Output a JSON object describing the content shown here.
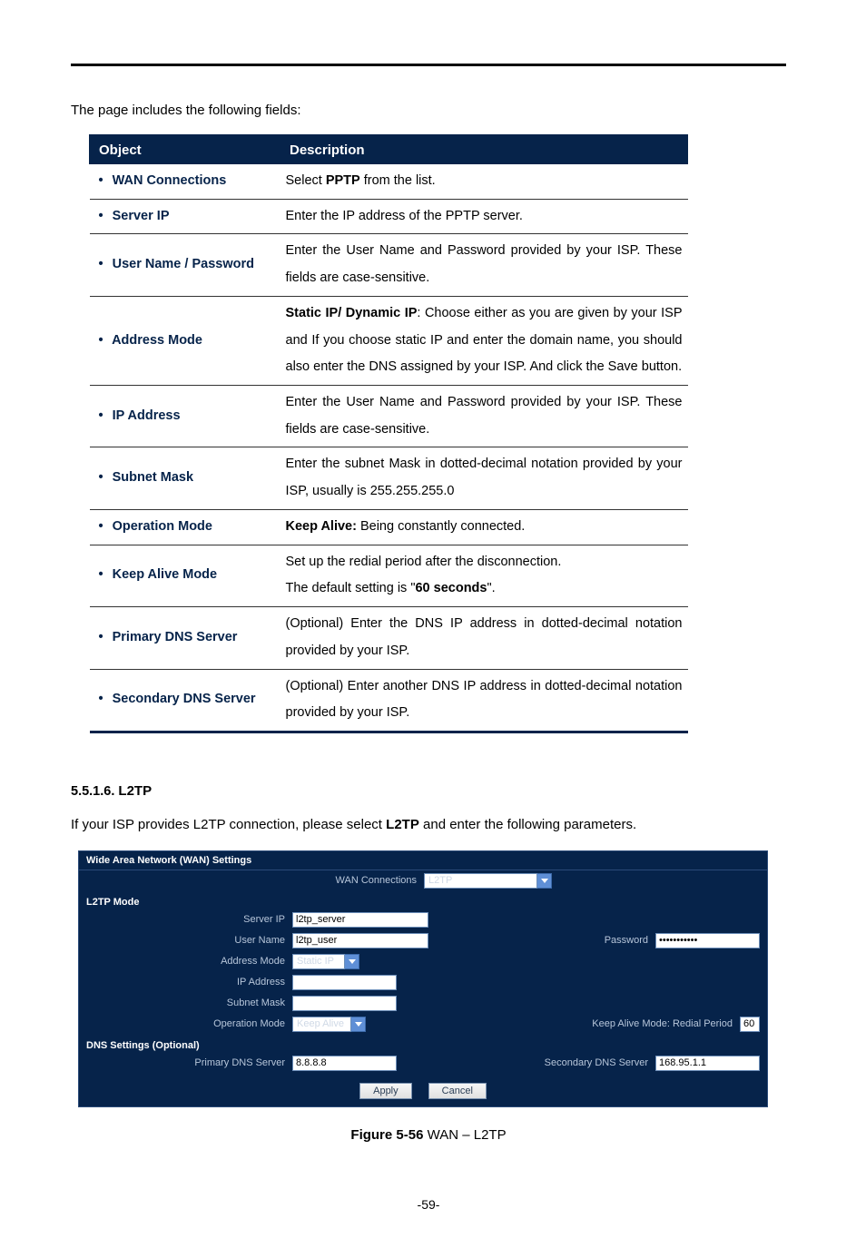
{
  "intro_text": "The page includes the following fields:",
  "table": {
    "head_object": "Object",
    "head_desc": "Description",
    "rows": [
      {
        "obj": "WAN Connections",
        "desc_html": "Select <b>PPTP</b> from the list."
      },
      {
        "obj": "Server IP",
        "desc_html": "Enter the IP address of the PPTP server."
      },
      {
        "obj": "User Name / Password",
        "desc_html": "Enter the User Name and Password provided by your ISP. These fields are case-sensitive."
      },
      {
        "obj": "Address Mode",
        "desc_html": "<b>Static IP/ Dynamic IP</b>: Choose either as you are given by your ISP and If you choose static IP and enter the domain name, you should also enter the DNS assigned by your ISP. And click the Save button."
      },
      {
        "obj": "IP Address",
        "desc_html": "Enter the User Name and Password provided by your ISP. These fields are case-sensitive."
      },
      {
        "obj": "Subnet Mask",
        "desc_html": "Enter the subnet Mask in dotted-decimal notation provided by your ISP, usually is 255.255.255.0"
      },
      {
        "obj": "Operation Mode",
        "desc_html": "<b>Keep Alive:</b> Being constantly connected."
      },
      {
        "obj": "Keep Alive Mode",
        "desc_html": "Set up the redial period after the disconnection.<br>The default setting is \"<b>60 seconds</b>\"."
      },
      {
        "obj": "Primary DNS Server",
        "desc_html": "(Optional) Enter the DNS IP address in dotted-decimal notation provided by your ISP."
      },
      {
        "obj": "Secondary DNS Server",
        "desc_html": "(Optional) Enter another DNS IP address in dotted-decimal notation provided by your ISP."
      }
    ]
  },
  "section": {
    "num": "5.5.1.6.",
    "title": "L2TP"
  },
  "after_paragraph_html": "If your ISP provides L2TP connection, please select <b>L2TP</b> and enter the following parameters.",
  "panel": {
    "title": "Wide Area Network (WAN) Settings",
    "wan_connections_label": "WAN Connections",
    "wan_connections_value": "L2TP",
    "mode_section": "L2TP Mode",
    "server_ip_label": "Server IP",
    "server_ip_value": "l2tp_server",
    "username_label": "User Name",
    "username_value": "l2tp_user",
    "password_label": "Password",
    "password_value": "•••••••••••",
    "address_mode_label": "Address Mode",
    "address_mode_value": "Static IP",
    "ip_address_label": "IP Address",
    "ip_address_value": "",
    "subnet_mask_label": "Subnet Mask",
    "subnet_mask_value": "",
    "operation_mode_label": "Operation Mode",
    "operation_mode_value": "Keep Alive",
    "keepalive_label": "Keep Alive Mode: Redial Period",
    "keepalive_value": "60",
    "dns_section": "DNS Settings (Optional)",
    "primary_dns_label": "Primary DNS Server",
    "primary_dns_value": "8.8.8.8",
    "secondary_dns_label": "Secondary DNS Server",
    "secondary_dns_value": "168.95.1.1",
    "apply_label": "Apply",
    "cancel_label": "Cancel"
  },
  "figure": {
    "num": "Figure 5-56",
    "caption": " WAN – L2TP"
  },
  "pagenum": "-59-"
}
